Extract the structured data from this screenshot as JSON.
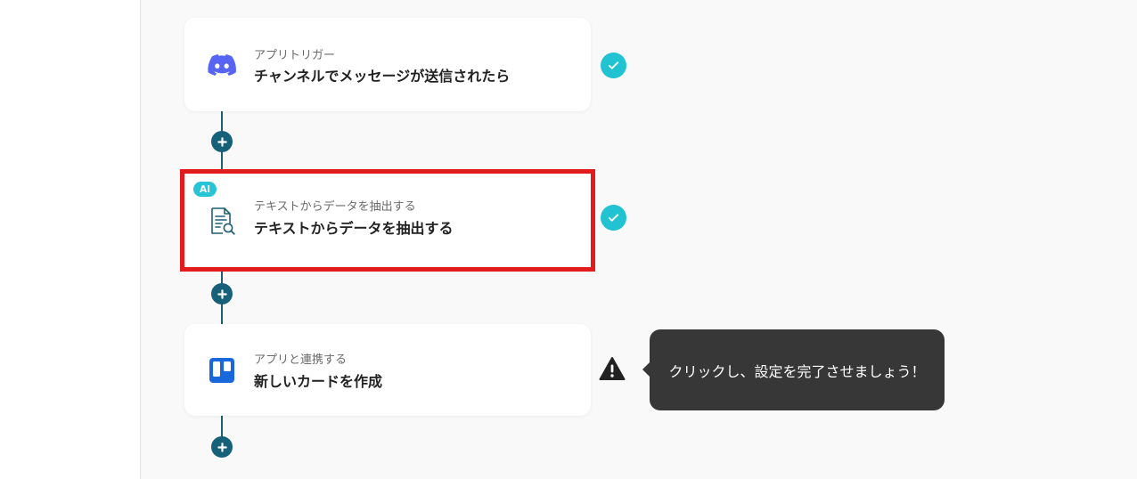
{
  "steps": [
    {
      "category": "アプリトリガー",
      "title": "チャンネルでメッセージが送信されたら",
      "icon": "discord-icon",
      "status": "complete"
    },
    {
      "badge": "AI",
      "category": "テキストからデータを抽出する",
      "title": "テキストからデータを抽出する",
      "icon": "document-search-icon",
      "status": "complete",
      "highlighted": true
    },
    {
      "category": "アプリと連携する",
      "title": "新しいカードを作成",
      "icon": "trello-icon",
      "status": "warning"
    }
  ],
  "tooltip": {
    "text": "クリックし、設定を完了させましょう！"
  },
  "colors": {
    "connector": "#1e5f74",
    "add_button": "#17607a",
    "check": "#21c2d2",
    "highlight": "#e21c1c",
    "ai_badge": "#27c3d6",
    "discord": "#5865f2",
    "trello": "#1868db",
    "tooltip_bg": "#373737"
  }
}
